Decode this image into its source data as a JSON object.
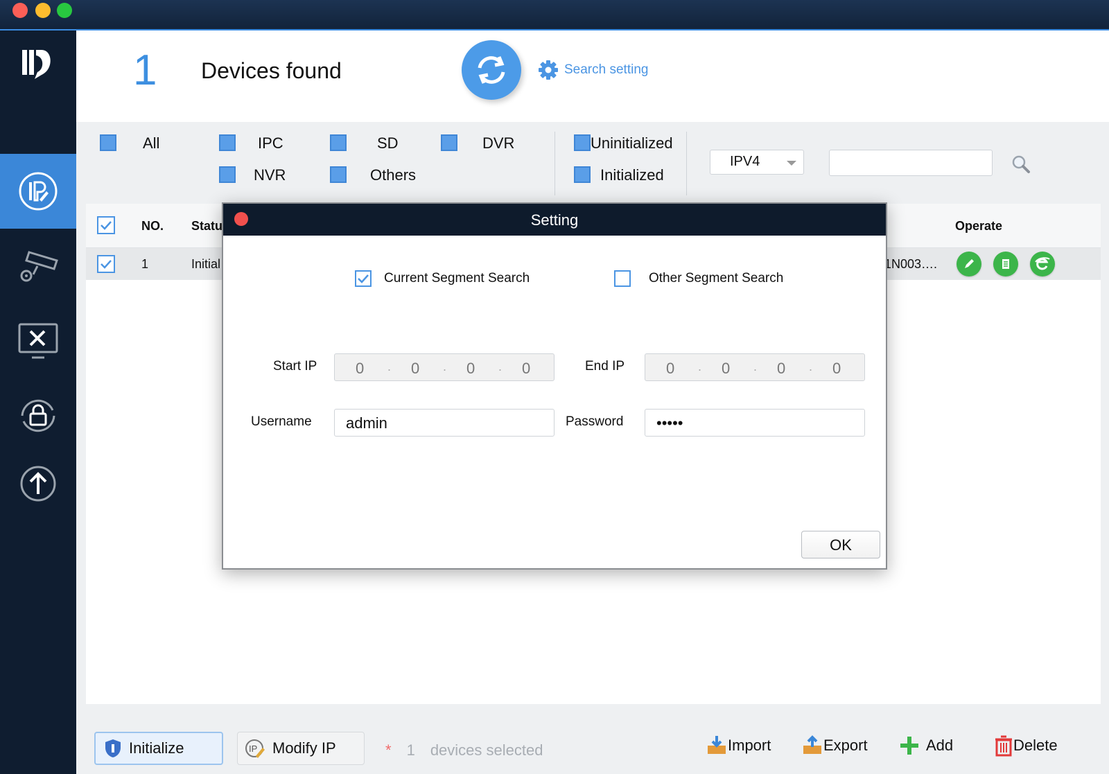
{
  "window": {
    "controls": [
      "close",
      "minimize",
      "zoom"
    ]
  },
  "sidebar": {
    "items": [
      {
        "name": "ip-config",
        "icon": "ip-icon",
        "active": true
      },
      {
        "name": "camera-settings",
        "icon": "camera-gear-icon",
        "active": false
      },
      {
        "name": "tools",
        "icon": "tools-monitor-icon",
        "active": false
      },
      {
        "name": "password-reset",
        "icon": "lock-refresh-icon",
        "active": false
      },
      {
        "name": "upgrade",
        "icon": "upload-icon",
        "active": false
      }
    ]
  },
  "header": {
    "count": "1",
    "found_label": "Devices found",
    "search_setting_label": "Search setting"
  },
  "filters": {
    "all": "All",
    "ipc": "IPC",
    "sd": "SD",
    "dvr": "DVR",
    "nvr": "NVR",
    "others": "Others",
    "uninitialized": "Uninitialized",
    "initialized": "Initialized",
    "ip_version": "IPV4",
    "search_value": ""
  },
  "table": {
    "headers": {
      "no": "NO.",
      "status": "Statu",
      "operate": "Operate"
    },
    "rows": [
      {
        "no": "1",
        "status": "Initial",
        "serial": "01N003…."
      }
    ]
  },
  "footer": {
    "initialize": "Initialize",
    "modify_ip": "Modify IP",
    "star": "*",
    "selected_count": "1",
    "selected_label": "devices selected",
    "import": "Import",
    "export": "Export",
    "add": "Add",
    "delete": "Delete"
  },
  "modal": {
    "title": "Setting",
    "current_segment": "Current Segment Search",
    "other_segment": "Other Segment Search",
    "start_ip_label": "Start IP",
    "end_ip_label": "End IP",
    "start_ip": [
      "0",
      "0",
      "0",
      "0"
    ],
    "end_ip": [
      "0",
      "0",
      "0",
      "0"
    ],
    "username_label": "Username",
    "username": "admin",
    "password_label": "Password",
    "password": "•••••",
    "ok": "OK"
  },
  "colors": {
    "accent": "#3b87d8",
    "sidebar": "#0f1d30",
    "green": "#3cb54a",
    "link": "#4b95e3"
  }
}
